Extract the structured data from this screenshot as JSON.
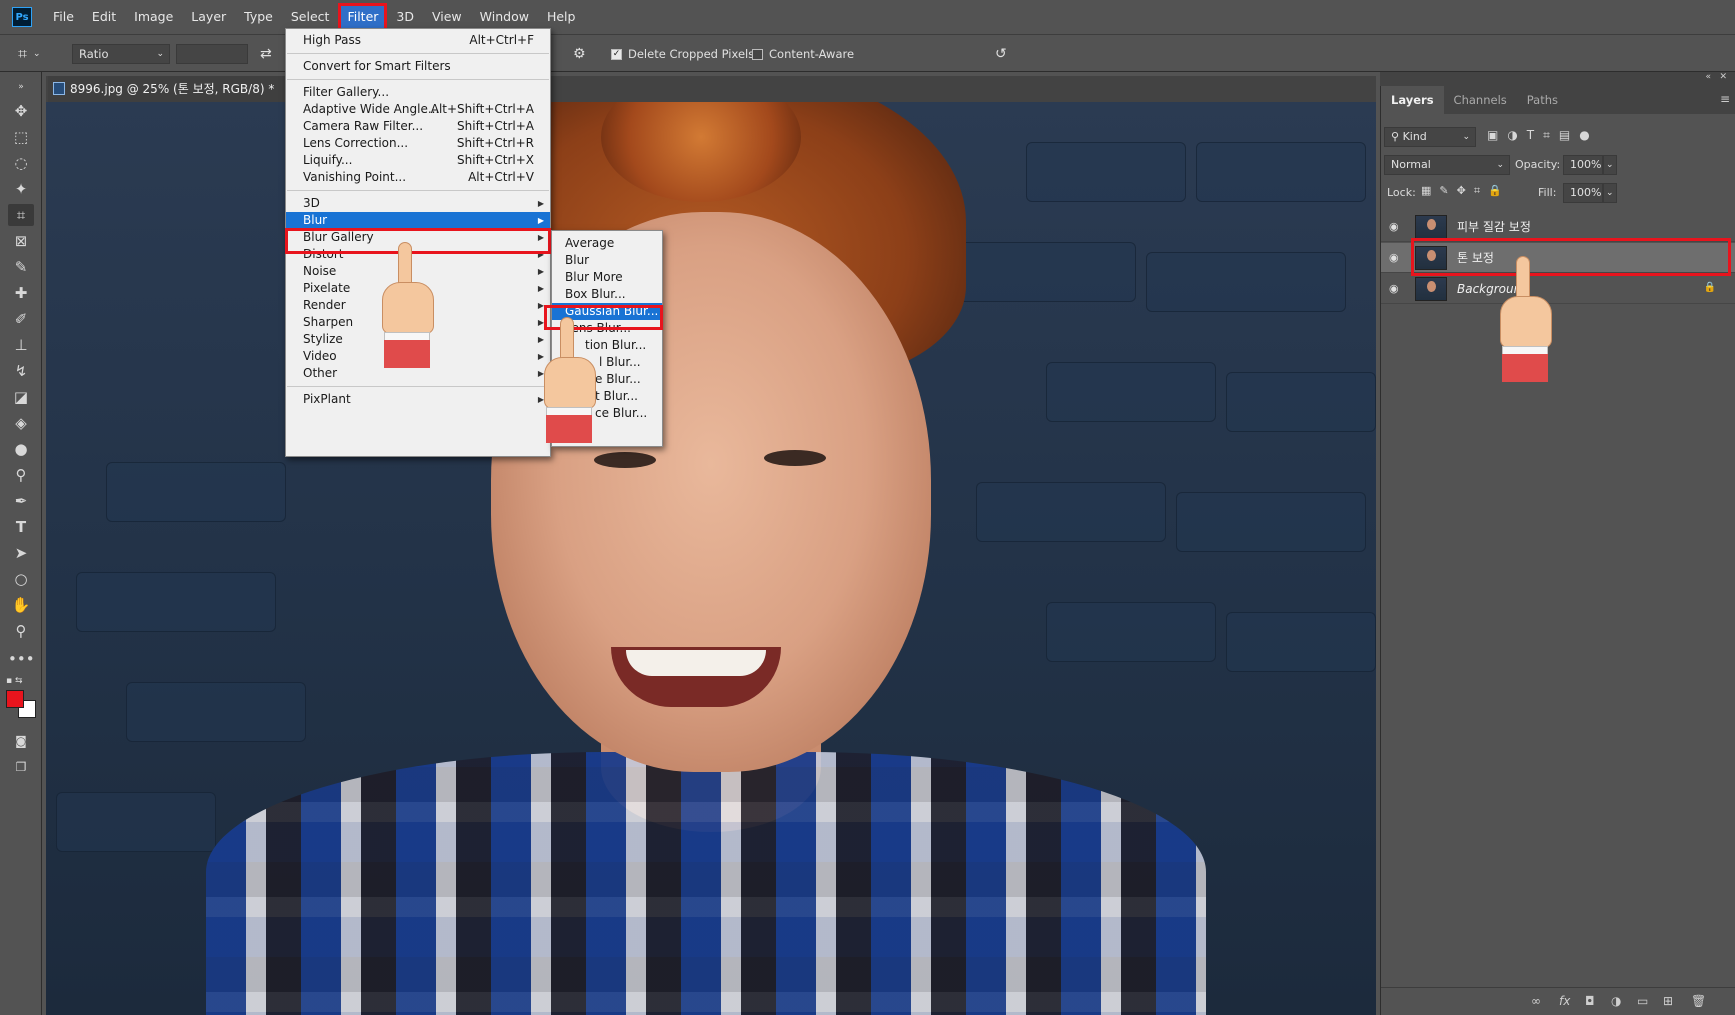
{
  "menubar": {
    "logo": "Ps",
    "items": [
      "File",
      "Edit",
      "Image",
      "Layer",
      "Type",
      "Select",
      "Filter",
      "3D",
      "View",
      "Window",
      "Help"
    ]
  },
  "options": {
    "ratio_label": "Ratio",
    "delete_cropped": "Delete Cropped Pixels",
    "content_aware": "Content-Aware"
  },
  "document": {
    "tab_title": "8996.jpg @ 25% (톤 보정, RGB/8) *"
  },
  "filter_menu": {
    "items": [
      {
        "label": "High Pass",
        "shortcut": "Alt+Ctrl+F"
      },
      {
        "label": "Convert for Smart Filters",
        "shortcut": ""
      },
      {
        "label": "Filter Gallery...",
        "shortcut": ""
      },
      {
        "label": "Adaptive Wide Angle...",
        "shortcut": "Alt+Shift+Ctrl+A"
      },
      {
        "label": "Camera Raw Filter...",
        "shortcut": "Shift+Ctrl+A"
      },
      {
        "label": "Lens Correction...",
        "shortcut": "Shift+Ctrl+R"
      },
      {
        "label": "Liquify...",
        "shortcut": "Shift+Ctrl+X"
      },
      {
        "label": "Vanishing Point...",
        "shortcut": "Alt+Ctrl+V"
      },
      {
        "label": "3D",
        "shortcut": ""
      },
      {
        "label": "Blur",
        "shortcut": ""
      },
      {
        "label": "Blur Gallery",
        "shortcut": ""
      },
      {
        "label": "Distort",
        "shortcut": ""
      },
      {
        "label": "Noise",
        "shortcut": ""
      },
      {
        "label": "Pixelate",
        "shortcut": ""
      },
      {
        "label": "Render",
        "shortcut": ""
      },
      {
        "label": "Sharpen",
        "shortcut": ""
      },
      {
        "label": "Stylize",
        "shortcut": ""
      },
      {
        "label": "Video",
        "shortcut": ""
      },
      {
        "label": "Other",
        "shortcut": ""
      },
      {
        "label": "PixPlant",
        "shortcut": ""
      }
    ]
  },
  "blur_menu": {
    "items": [
      "Average",
      "Blur",
      "Blur More",
      "Box Blur...",
      "Gaussian Blur...",
      "Lens Blur...",
      "Motion Blur...",
      "Radial Blur...",
      "Shape Blur...",
      "Smart Blur...",
      "Surface Blur..."
    ],
    "visible_labels": [
      "Average",
      "Blur",
      "Blur More",
      "Box Blur...",
      "Gaussian Blur...",
      "Lens Blur...",
      "tion Blur...",
      "l Blur...",
      "e Blur...",
      "t Blur...",
      "ce Blur..."
    ]
  },
  "layers_panel": {
    "tabs": [
      "Layers",
      "Channels",
      "Paths"
    ],
    "kind": "Kind",
    "blend_mode": "Normal",
    "opacity_label": "Opacity:",
    "opacity": "100%",
    "lock_label": "Lock:",
    "fill_label": "Fill:",
    "fill": "100%",
    "layers": [
      {
        "name": "피부 질감 보정",
        "selected": false,
        "italic": false,
        "locked": false
      },
      {
        "name": "톤 보정",
        "selected": true,
        "italic": false,
        "locked": false
      },
      {
        "name": "Background",
        "selected": false,
        "italic": true,
        "locked": true
      }
    ]
  },
  "colors": {
    "highlight": "#1973d4",
    "annotation": "#e8141d",
    "foreground_swatch": "#e8141d",
    "background_swatch": "#ffffff"
  }
}
